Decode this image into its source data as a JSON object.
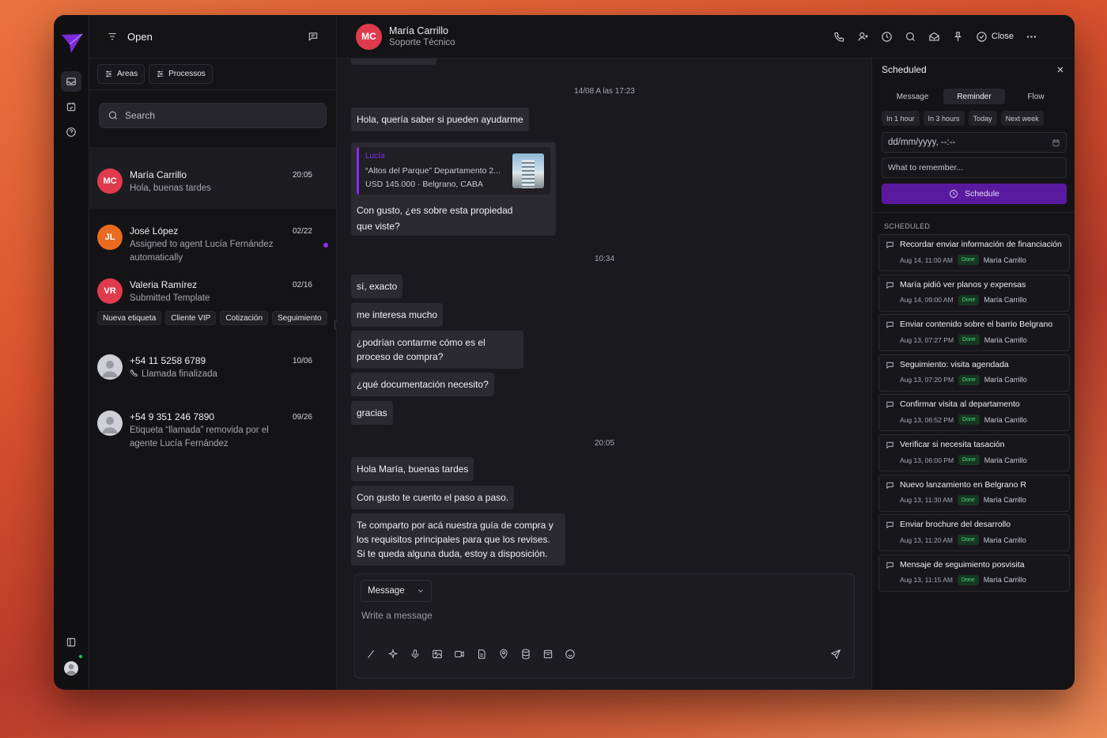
{
  "list": {
    "title": "Open",
    "filters": [
      "Areas",
      "Processos"
    ],
    "search_placeholder": "Search",
    "conversations": [
      {
        "initials": "MC",
        "name": "María Carrillo",
        "time": "20:05",
        "preview": "Hola, buenas tardes",
        "color": "#e03b4d"
      },
      {
        "initials": "JL",
        "name": "José López",
        "time": "02/22",
        "preview": "Assigned to agent Lucía Fernández automatically",
        "color": "#ea6a1f"
      },
      {
        "initials": "VR",
        "name": "Valeria Ramírez",
        "time": "02/16",
        "preview": "Submitted Template",
        "color": "#e03b4d"
      },
      {
        "initials": "",
        "name": "+54 11 5258 6789",
        "time": "10/06",
        "preview": "Llamada finalizada",
        "color": "#cfcfd6"
      },
      {
        "initials": "",
        "name": "+54 9 351 246 7890",
        "time": "09/26",
        "preview": "Etiqueta “llamada” removida por el agente Lucía Fernández",
        "color": "#cfcfd6"
      }
    ],
    "tags": [
      "Nueva etiqueta",
      "Cliente VIP",
      "Cotización",
      "Seguimiento"
    ]
  },
  "chat": {
    "initials": "MC",
    "name": "María Carrillo",
    "subtitle": "Soporte Técnico",
    "close_label": "Close",
    "stamps": [
      "14/08 A las 17:23",
      "10:34",
      "20:05"
    ],
    "card": {
      "quoted_author": "Lucía",
      "quoted_line1": "“Altos del Parque” Departamento 2...",
      "quoted_line2": "USD 145.000 · Belgrano, CABA",
      "text": "Con gusto, ¿es sobre esta propiedad que viste?"
    },
    "messages": [
      "Hola, quería saber si pueden ayudarme",
      "sí, exacto",
      "me interesa mucho",
      "¿podrían contarme cómo es el proceso de compra?",
      "¿qué documentación necesito?",
      "gracias",
      "Hola María, buenas tardes",
      "Con gusto te cuento el paso a paso.",
      "Te comparto por acá nuestra guía de compra y los requisitos principales para que los revises. Si te queda alguna duda, estoy a disposición."
    ],
    "composer": {
      "type": "Message",
      "placeholder": "Write a message"
    }
  },
  "panel": {
    "title": "Scheduled",
    "tabs": [
      "Message",
      "Reminder",
      "Flow"
    ],
    "quick": [
      "In 1 hour",
      "In 3 hours",
      "Today",
      "Next week"
    ],
    "date_placeholder": "dd/mm/yyyy, --:--",
    "note_placeholder": "What to remember...",
    "schedule_label": "Schedule",
    "section_label": "SCHEDULED",
    "items": [
      {
        "title": "Recordar enviar información de financiación",
        "date": "Aug 14, 11:00 AM",
        "status": "Done",
        "by": "María Carrillo"
      },
      {
        "title": "María pidió ver planos y expensas",
        "date": "Aug 14, 09:00 AM",
        "status": "Done",
        "by": "María Carrillo"
      },
      {
        "title": "Enviar contenido sobre el barrio Belgrano",
        "date": "Aug 13, 07:27 PM",
        "status": "Done",
        "by": "María Carrillo"
      },
      {
        "title": "Seguimiento: visita agendada",
        "date": "Aug 13, 07:20 PM",
        "status": "Done",
        "by": "María Carrillo"
      },
      {
        "title": "Confirmar visita al departamento",
        "date": "Aug 13, 06:52 PM",
        "status": "Done",
        "by": "María Carrillo"
      },
      {
        "title": "Verificar si necesita tasación",
        "date": "Aug 13, 06:00 PM",
        "status": "Done",
        "by": "María Carrillo"
      },
      {
        "title": "Nuevo lanzamiento en Belgrano R",
        "date": "Aug 13, 11:30 AM",
        "status": "Done",
        "by": "María Carrillo"
      },
      {
        "title": "Enviar brochure del desarrollo",
        "date": "Aug 13, 11:20 AM",
        "status": "Done",
        "by": "María Carrillo"
      },
      {
        "title": "Mensaje de seguimiento posvisita",
        "date": "Aug 13, 11:15 AM",
        "status": "Done",
        "by": "María Carrillo"
      }
    ]
  },
  "colors": {
    "accent": "#8b2cf5",
    "done": "#4ade80",
    "online": "#22c55e"
  }
}
